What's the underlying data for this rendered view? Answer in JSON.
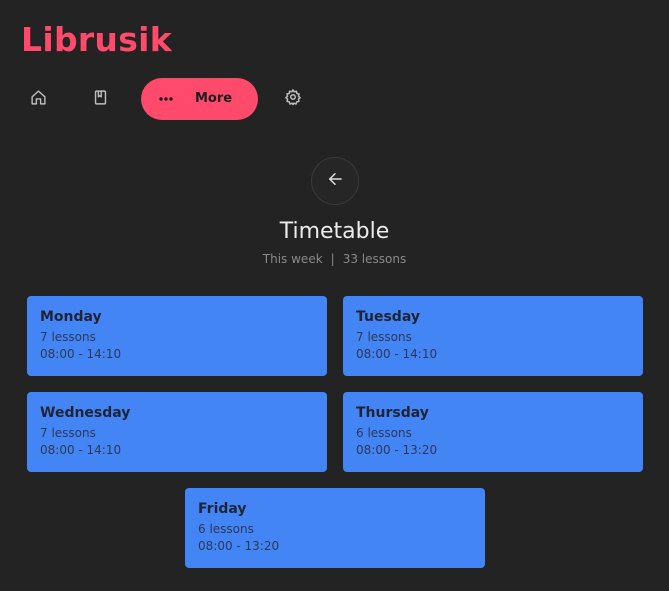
{
  "app": {
    "title": "Librusik"
  },
  "nav": {
    "home_icon": "home-icon",
    "book_icon": "book-icon",
    "more_icon": "more-dots-icon",
    "more_label": "More",
    "settings_icon": "gear-icon",
    "active_color": "#ff4a6b"
  },
  "page": {
    "back_icon": "arrow-left-icon",
    "title": "Timetable",
    "period": "This week",
    "separator": "|",
    "total_lessons": "33 lessons"
  },
  "days": [
    {
      "name": "Monday",
      "lessons": "7 lessons",
      "hours": "08:00 - 14:10"
    },
    {
      "name": "Tuesday",
      "lessons": "7 lessons",
      "hours": "08:00 - 14:10"
    },
    {
      "name": "Wednesday",
      "lessons": "7 lessons",
      "hours": "08:00 - 14:10"
    },
    {
      "name": "Thursday",
      "lessons": "6 lessons",
      "hours": "08:00 - 13:20"
    },
    {
      "name": "Friday",
      "lessons": "6 lessons",
      "hours": "08:00 - 13:20"
    }
  ],
  "colors": {
    "background": "#232323",
    "card": "#4485f5",
    "accent": "#ff4a6b"
  }
}
